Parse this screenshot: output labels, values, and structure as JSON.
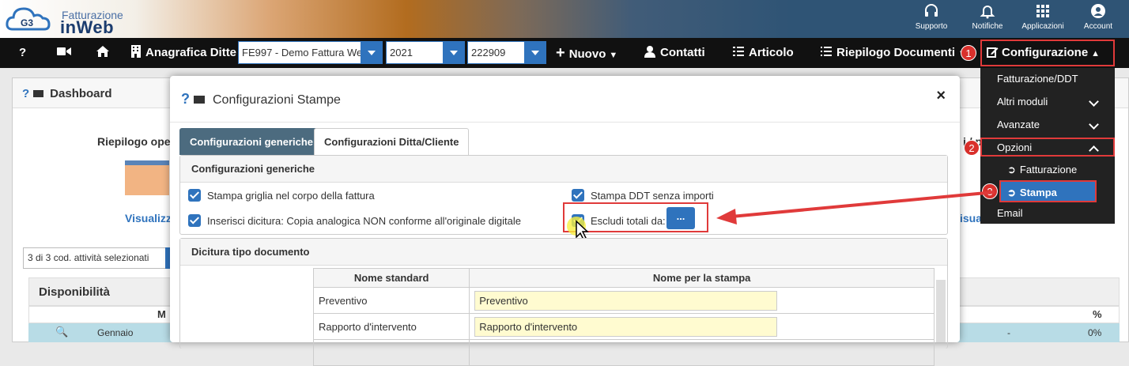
{
  "app": {
    "logo_line1": "Fatturazione",
    "logo_line2": "inWeb",
    "logo_badge": "G3"
  },
  "topbar": [
    {
      "label": "Supporto",
      "icon": "headset-icon"
    },
    {
      "label": "Notifiche",
      "icon": "bell-icon"
    },
    {
      "label": "Applicazioni",
      "icon": "grid-icon"
    },
    {
      "label": "Account",
      "icon": "user-icon"
    }
  ],
  "navbar": {
    "help": "?",
    "anagrafica": "Anagrafica Ditte",
    "ditta_select": "FE997 - Demo Fattura Web",
    "year_select": "2021",
    "code_select": "222909",
    "nuovo": "Nuovo",
    "contatti": "Contatti",
    "articolo": "Articolo",
    "riepilogo": "Riepilogo Documenti",
    "configurazione": "Configurazione"
  },
  "badges": [
    "1",
    "2",
    "3"
  ],
  "menu": {
    "items": [
      "Fatturazione/DDT",
      "Altri moduli",
      "Avanzate",
      "Opzioni",
      "Fatturazione",
      "Stampa",
      "Email"
    ]
  },
  "background": {
    "dashboard": "Dashboard",
    "riepilogo": "Riepilogo ope",
    "visualizza": "Visualizz",
    "right_vis": "isua",
    "right_i": "i / p",
    "activity_select": "3 di 3 cod. attività selezionati",
    "disponibilita": "Disponibilità",
    "col_m": "M",
    "col_pct": "%",
    "row_month": "Gennaio",
    "row_dash": "-",
    "row_pct": "0%"
  },
  "modal": {
    "help": "?",
    "title": "Configurazioni Stampe",
    "close": "×",
    "tabs": [
      "Configurazioni generiche",
      "Configurazioni Ditta/Cliente"
    ],
    "section1": {
      "title": "Configurazioni generiche",
      "options": [
        "Stampa griglia nel corpo della fattura",
        "Stampa DDT senza importi",
        "Inserisci dicitura: Copia analogica NON conforme all'originale digitale",
        "Escludi totali da:"
      ],
      "dots_button": "..."
    },
    "section2": {
      "title": "Dicitura tipo documento",
      "headers": [
        "Nome standard",
        "Nome per la stampa"
      ],
      "rows": [
        {
          "standard": "Preventivo",
          "stampa": "Preventivo"
        },
        {
          "standard": "Rapporto d'intervento",
          "stampa": "Rapporto d'intervento"
        }
      ]
    }
  },
  "colors": {
    "accent": "#2f73bd",
    "highlight": "#e03a3a",
    "navbar": "#111111"
  }
}
